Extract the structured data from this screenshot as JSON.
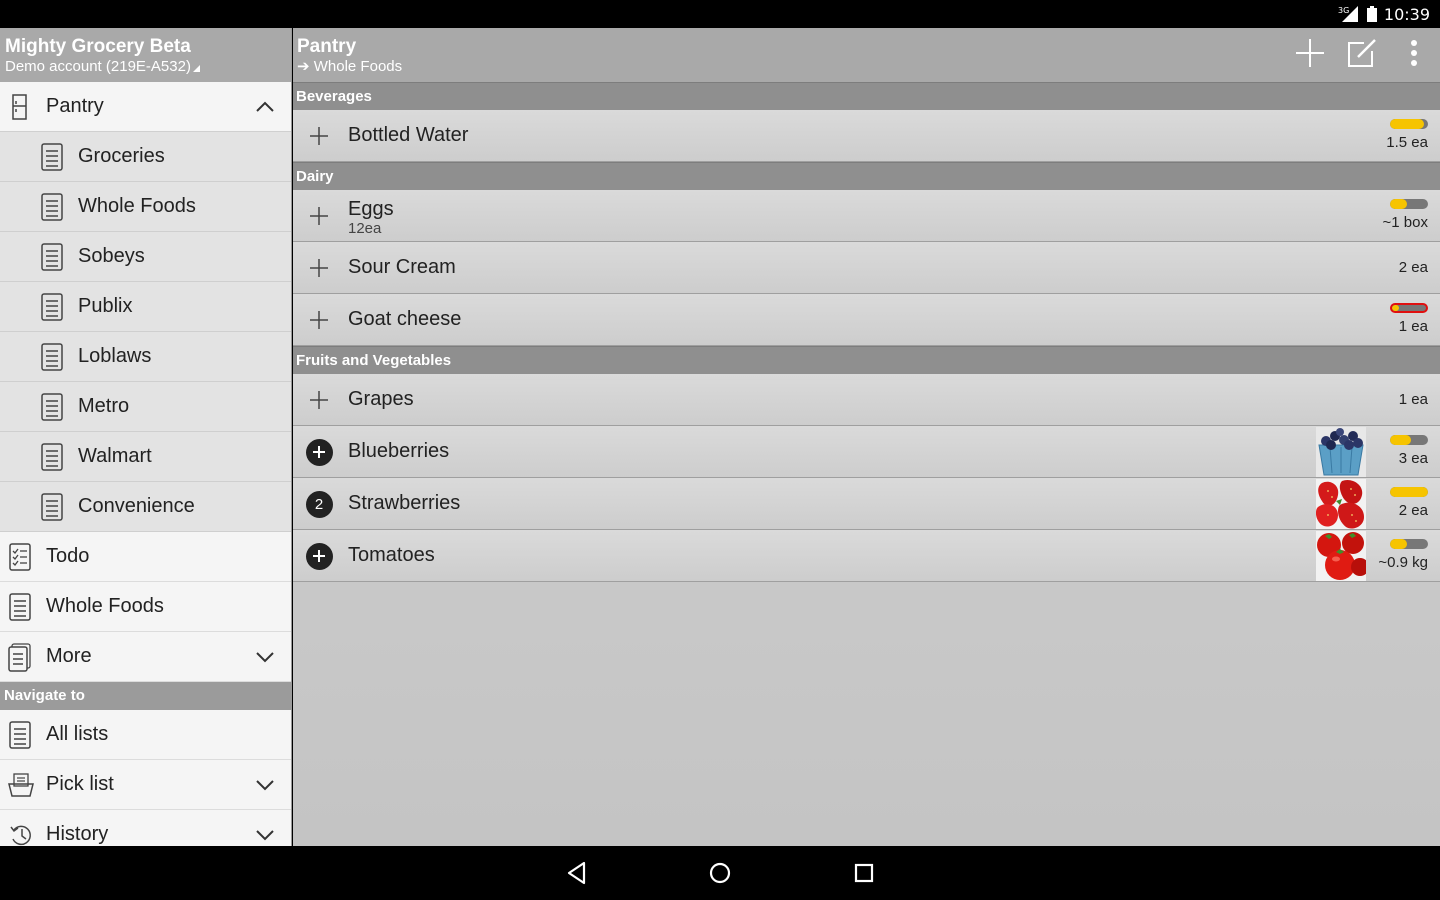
{
  "status": {
    "network": "3G",
    "time": "10:39"
  },
  "drawer": {
    "title": "Mighty Grocery Beta",
    "account": "Demo account (219E-A532)",
    "pantry": {
      "label": "Pantry"
    },
    "lists": [
      {
        "label": "Groceries"
      },
      {
        "label": "Whole Foods"
      },
      {
        "label": "Sobeys"
      },
      {
        "label": "Publix"
      },
      {
        "label": "Loblaws"
      },
      {
        "label": "Metro"
      },
      {
        "label": "Walmart"
      },
      {
        "label": "Convenience"
      }
    ],
    "todo": {
      "label": "Todo"
    },
    "whole_foods": {
      "label": "Whole Foods"
    },
    "more": {
      "label": "More"
    },
    "navigate_header": "Navigate to",
    "all_lists": {
      "label": "All lists"
    },
    "pick_list": {
      "label": "Pick list"
    },
    "history": {
      "label": "History"
    }
  },
  "toolbar": {
    "title": "Pantry",
    "subtitle": "Whole Foods",
    "subtitle_arrow": "➔"
  },
  "sections": [
    {
      "name": "Beverages",
      "items": [
        {
          "name": "Bottled Water",
          "qty": "1.5 ea",
          "level": 0.9
        }
      ]
    },
    {
      "name": "Dairy",
      "items": [
        {
          "name": "Eggs",
          "sub": "12ea",
          "qty": "~1 box",
          "level": 0.45
        },
        {
          "name": "Sour Cream",
          "qty": "2 ea"
        },
        {
          "name": "Goat cheese",
          "qty": "1 ea",
          "level": 0.2,
          "low": true
        }
      ]
    },
    {
      "name": "Fruits and Vegetables",
      "items": [
        {
          "name": "Grapes",
          "qty": "1 ea"
        },
        {
          "name": "Blueberries",
          "qty": "3 ea",
          "level": 0.55
        },
        {
          "name": "Strawberries",
          "qty": "2 ea",
          "level": 1.0,
          "badge": "2"
        },
        {
          "name": "Tomatoes",
          "qty": "~0.9 kg",
          "level": 0.45
        }
      ]
    }
  ],
  "colors": {
    "header_bg": "#a9a9a9",
    "section_bg": "#8f8f8f",
    "level_fill": "#f6c400",
    "level_low": "#e01010"
  },
  "icons": {
    "add": "plus-icon",
    "edit": "edit-icon",
    "menu": "overflow-menu-icon",
    "back": "back-icon",
    "home": "home-icon",
    "recents": "recents-icon"
  }
}
